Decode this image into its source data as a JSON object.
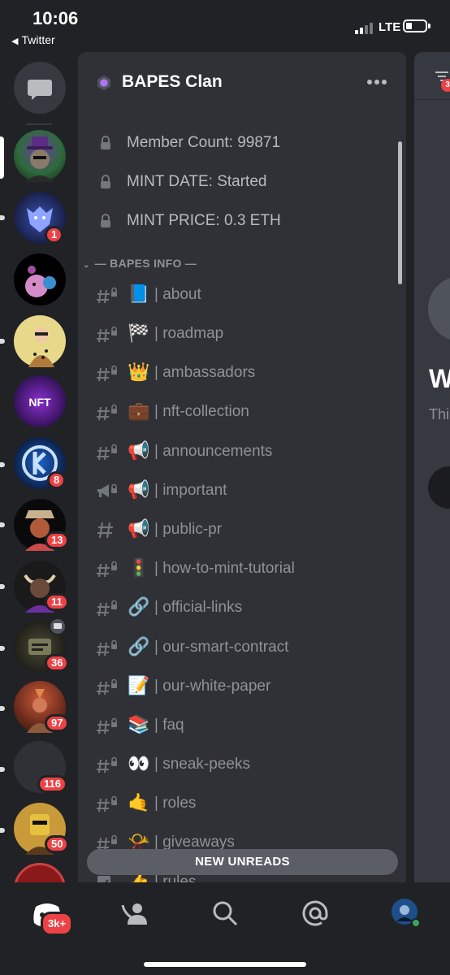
{
  "status_bar": {
    "time": "10:06",
    "back_label": "Twitter",
    "network": "LTE"
  },
  "server_rail": {
    "servers": [
      {
        "name": "BAPES Clan",
        "selected": true,
        "badge": ""
      },
      {
        "name": "server-2",
        "badge": "1"
      },
      {
        "name": "server-3",
        "badge": ""
      },
      {
        "name": "server-4",
        "badge": ""
      },
      {
        "name": "NFT",
        "label": "NFT",
        "badge": ""
      },
      {
        "name": "server-6",
        "badge": "8"
      },
      {
        "name": "server-7",
        "badge": "13"
      },
      {
        "name": "server-8",
        "badge": "11"
      },
      {
        "name": "server-9",
        "badge": "36"
      },
      {
        "name": "server-10",
        "badge": "97"
      },
      {
        "name": "server-11",
        "badge": "116"
      },
      {
        "name": "server-12",
        "badge": "50"
      }
    ]
  },
  "guild": {
    "name": "BAPES Clan",
    "info_channels": [
      "Member Count: 99871",
      "MINT DATE: Started",
      "MINT PRICE: 0.3 ETH"
    ],
    "category": "— BAPES INFO —",
    "channels": [
      {
        "emoji": "📘",
        "name": "| about",
        "icon": "locked-text-channel-icon"
      },
      {
        "emoji": "🏁",
        "name": "| roadmap",
        "icon": "locked-text-channel-icon"
      },
      {
        "emoji": "👑",
        "name": "| ambassadors",
        "icon": "locked-text-channel-icon"
      },
      {
        "emoji": "💼",
        "name": "| nft-collection",
        "icon": "locked-text-channel-icon"
      },
      {
        "emoji": "📢",
        "name": "| announcements",
        "icon": "locked-text-channel-icon"
      },
      {
        "emoji": "📢",
        "name": "| important",
        "icon": "announcement-channel-icon"
      },
      {
        "emoji": "📢",
        "name": "| public-pr",
        "icon": "text-channel-icon"
      },
      {
        "emoji": "🚦",
        "name": "| how-to-mint-tutorial",
        "icon": "locked-text-channel-icon"
      },
      {
        "emoji": "🔗",
        "name": "| official-links",
        "icon": "locked-text-channel-icon"
      },
      {
        "emoji": "🔗",
        "name": "| our-smart-contract",
        "icon": "locked-text-channel-icon"
      },
      {
        "emoji": "📝",
        "name": "| our-white-paper",
        "icon": "locked-text-channel-icon"
      },
      {
        "emoji": "📚",
        "name": "| faq",
        "icon": "locked-text-channel-icon"
      },
      {
        "emoji": "👀",
        "name": "| sneak-peeks",
        "icon": "locked-text-channel-icon"
      },
      {
        "emoji": "🤙",
        "name": "| roles",
        "icon": "locked-text-channel-icon"
      },
      {
        "emoji": "📯",
        "name": "| giveaways",
        "icon": "locked-text-channel-icon"
      },
      {
        "emoji": "👍",
        "name": "| rules",
        "icon": "rules-channel-icon"
      }
    ],
    "new_unreads_label": "NEW UNREADS"
  },
  "chat_peek": {
    "heading_fragment": "W",
    "body_fragment": "Thi",
    "filter_badge": "3"
  },
  "tab_bar": {
    "home_badge": "3k+"
  },
  "colors": {
    "background": "#202225",
    "panel": "#2f3136",
    "chat": "#36393f",
    "badge_red": "#ed4245",
    "muted_text": "#8e9297"
  }
}
